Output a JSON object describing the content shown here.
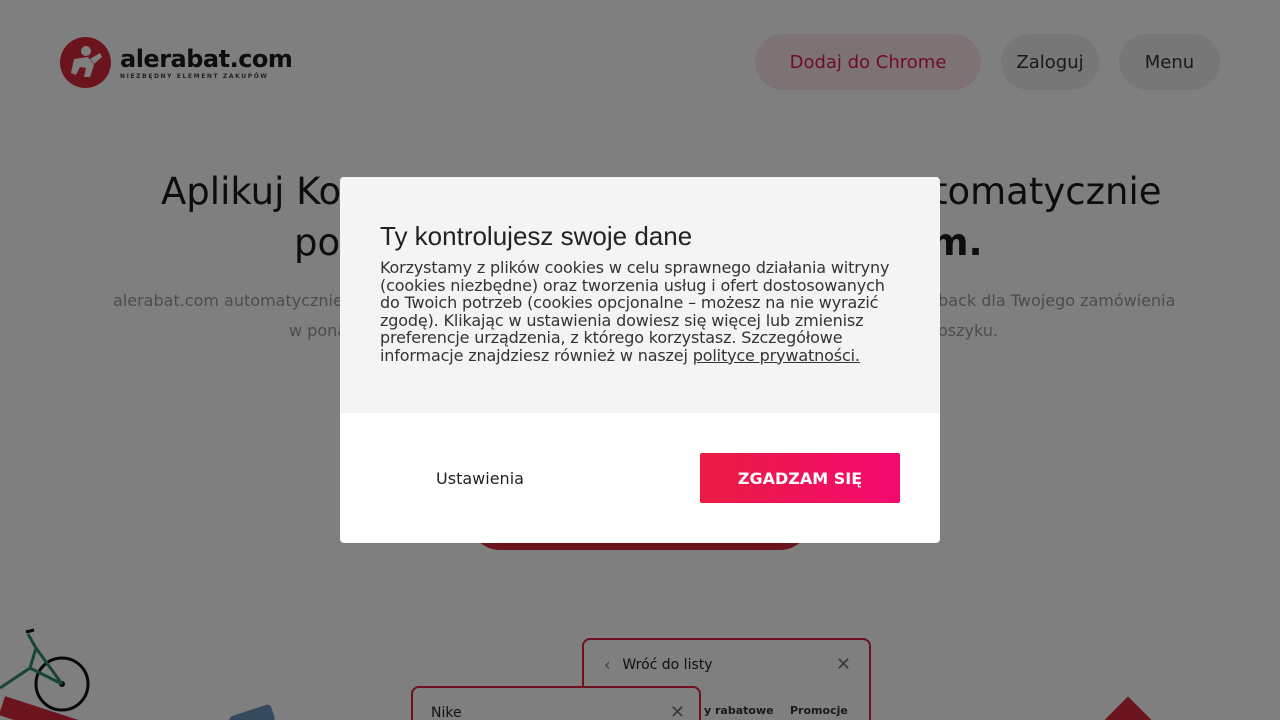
{
  "header": {
    "logo_name": "alerabat.com",
    "logo_tagline": "NIEZBĘDNY ELEMENT ZAKUPÓW",
    "chrome_button": "Dodaj do Chrome",
    "login_button": "Zaloguj",
    "menu_button": "Menu"
  },
  "hero": {
    "title_line1_start": "Aplikuj Koo",
    "title_line1_end": "tomatycznie",
    "title_line2_start": "po",
    "title_line2_end": "m.",
    "subtitle_line1_start": "alerabat.com automatycznie z",
    "subtitle_line1_end": "nback dla Twojego zamówienia",
    "subtitle_line2_start": "w pona",
    "subtitle_line2_end": "oszyku."
  },
  "illustration": {
    "back_card_title": "Wróć do listy",
    "back_card_tab1": "y rabatowe",
    "back_card_tab2": "Promocje",
    "front_card_title": "Nike"
  },
  "modal": {
    "title": "Ty kontrolujesz swoje dane",
    "text": "Korzystamy z plików cookies w celu sprawnego działania witryny (cookies niezbędne) oraz tworzenia usług i ofert dostosowanych do Twoich potrzeb (cookies opcjonalne – możesz na nie wyrazić zgodę). Klikając w ustawienia dowiesz się więcej lub zmienisz preferencje urządzenia, z którego korzystasz. Szczegółowe informacje znajdziesz również w naszej ",
    "privacy_link": "polityce prywatności.",
    "settings_button": "Ustawienia",
    "accept_button": "ZGADZAM SIĘ"
  },
  "colors": {
    "brand_red": "#d8283a",
    "accent_pink": "#e01b45",
    "accept_gradient_start": "#ea1c43",
    "accept_gradient_end": "#f40a6f"
  }
}
